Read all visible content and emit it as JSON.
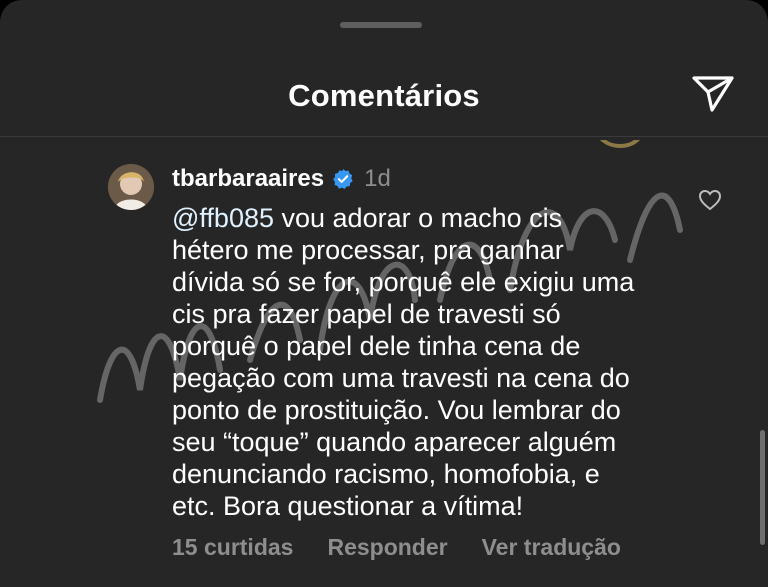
{
  "header": {
    "title": "Comentários"
  },
  "comment": {
    "username": "tbarbaraaires",
    "time": "1d",
    "mention": "@ffb085",
    "text": " vou adorar o macho cis\nhétero me processar, pra ganhar\ndívida só se for, porquê ele exigiu uma\ncis pra fazer papel de travesti só\nporquê o papel dele tinha cena de\npegação com uma travesti na cena do\nponto de prostituição. Vou lembrar do\nseu “toque” quando aparecer alguém\ndenunciando racismo, homofobia, e\netc. Bora questionar a vítima!",
    "likes_label": "15 curtidas",
    "reply_label": "Responder",
    "translate_label": "Ver tradução"
  },
  "icons": {
    "send": "send-icon",
    "heart": "heart-outline-icon",
    "verified": "verified-badge-icon"
  },
  "colors": {
    "background": "#262626",
    "verified": "#3897f0",
    "muted": "#8e8e8e"
  }
}
